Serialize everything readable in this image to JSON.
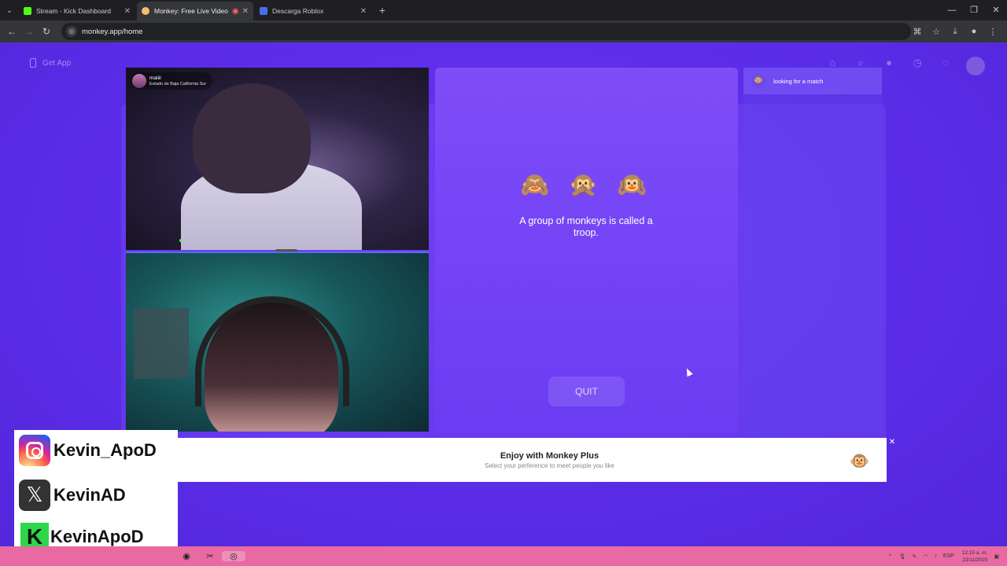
{
  "browser": {
    "tabs": [
      {
        "title": "Stream - Kick Dashboard",
        "favicon_color": "#53fc18",
        "active": false
      },
      {
        "title": "Monkey: Free Live Video Ch",
        "favicon_color": "#f0c070",
        "active": true
      },
      {
        "title": "Descarga Roblox",
        "favicon_color": "#4a6cf0",
        "active": false
      }
    ],
    "url": "monkey.app/home"
  },
  "page": {
    "get_app_label": "Get App",
    "notification_count": "2",
    "peer": {
      "name": "maliii",
      "location": "Estado de Baja California Sur"
    },
    "center": {
      "emojis": "🙈 🙊 🙉",
      "fact_text": "A group of monkeys is called a troop.",
      "quit_label": "QUIT"
    },
    "chat": {
      "status": "looking for a match"
    },
    "promo": {
      "title": "Enjoy with Monkey Plus",
      "subtitle": "Select your perference to meet people you like",
      "close_label": "✕"
    }
  },
  "overlay": {
    "instagram": "Kevin_ApoD",
    "x": "KevinAD",
    "kick": "KevinApoD"
  },
  "taskbar": {
    "lang": "ESP",
    "time": "12:15 a. m.",
    "date": "23/11/2025"
  },
  "colors": {
    "page_bg": "#5a2be6",
    "card": "#7f4cf7",
    "taskbar": "#e96aa3"
  }
}
